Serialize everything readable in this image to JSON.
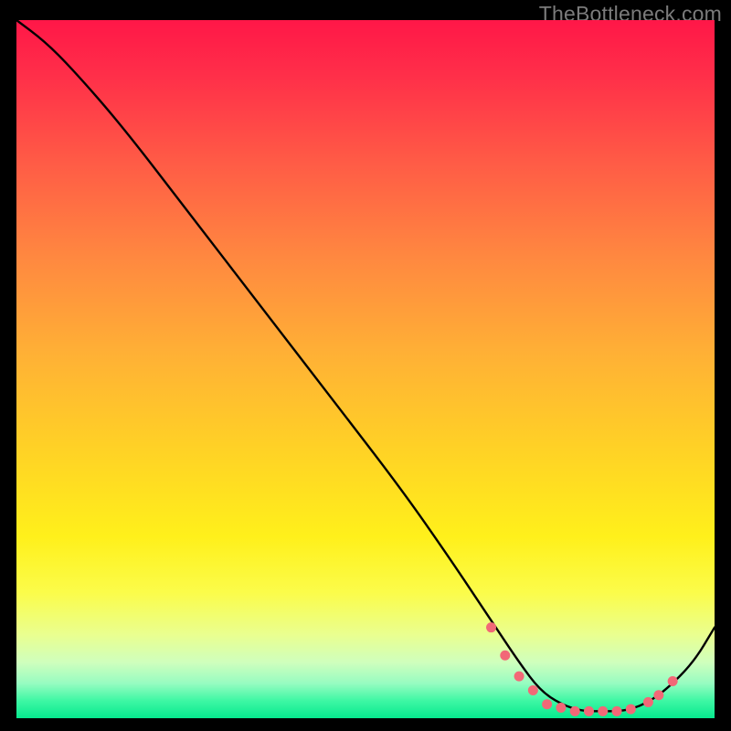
{
  "watermark": "TheBottleneck.com",
  "chart_data": {
    "type": "line",
    "title": "",
    "xlabel": "",
    "ylabel": "",
    "xlim": [
      0,
      100
    ],
    "ylim": [
      0,
      100
    ],
    "grid": false,
    "series": [
      {
        "name": "curve",
        "stroke": "#000000",
        "x": [
          0,
          4,
          8,
          15,
          25,
          35,
          45,
          55,
          62,
          68,
          72,
          75,
          78,
          81,
          84,
          87,
          90,
          93,
          97,
          100
        ],
        "y": [
          100,
          97,
          93,
          85,
          72,
          59,
          46,
          33,
          23,
          14,
          8,
          4,
          2,
          1,
          1,
          1,
          2,
          4,
          8,
          13
        ]
      }
    ],
    "markers": {
      "name": "flat-zone",
      "color": "#f26877",
      "x": [
        68,
        70,
        72,
        74,
        76,
        78,
        80,
        82,
        84,
        86,
        88,
        90.5,
        92,
        94
      ],
      "y": [
        13,
        9,
        6,
        4,
        2,
        1.5,
        1,
        1,
        1,
        1,
        1.3,
        2.3,
        3.3,
        5.3
      ]
    }
  }
}
